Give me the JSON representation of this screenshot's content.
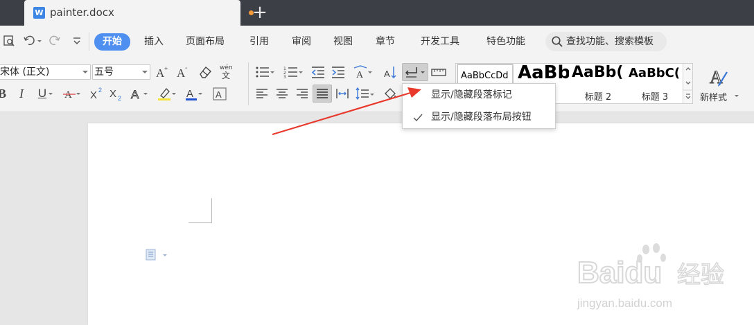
{
  "window": {
    "tab_title": "painter.docx",
    "new_tab_symbol": "+"
  },
  "menubar": {
    "tabs": [
      "开始",
      "插入",
      "页面布局",
      "引用",
      "审阅",
      "视图",
      "章节",
      "开发工具",
      "特色功能"
    ],
    "active_tab": "开始",
    "search_text": "查找功能、搜索模板"
  },
  "ribbon": {
    "font_name": "宋体 (正文)",
    "font_size": "五号",
    "styles": [
      {
        "sample": "AaBbCcDd",
        "caption": ""
      },
      {
        "sample": "AaBb",
        "caption": ""
      },
      {
        "sample": "AaBb(",
        "caption": "标题 2"
      },
      {
        "sample": "AaBbC(",
        "caption": "标题 3"
      }
    ],
    "new_style_label": "新样式"
  },
  "dropdown": {
    "items": [
      {
        "label": "显示/隐藏段落标记",
        "checked": false
      },
      {
        "label": "显示/隐藏段落布局按钮",
        "checked": true
      }
    ]
  },
  "watermark": {
    "brand": "Baidu",
    "brand_cn": "经验",
    "url": "jingyan.baidu.com"
  },
  "colors": {
    "accent": "#4f8ff0",
    "titlebar": "#3c3f46",
    "arrow": "#e8392c",
    "unsaved_dot": "#f39a3a"
  }
}
